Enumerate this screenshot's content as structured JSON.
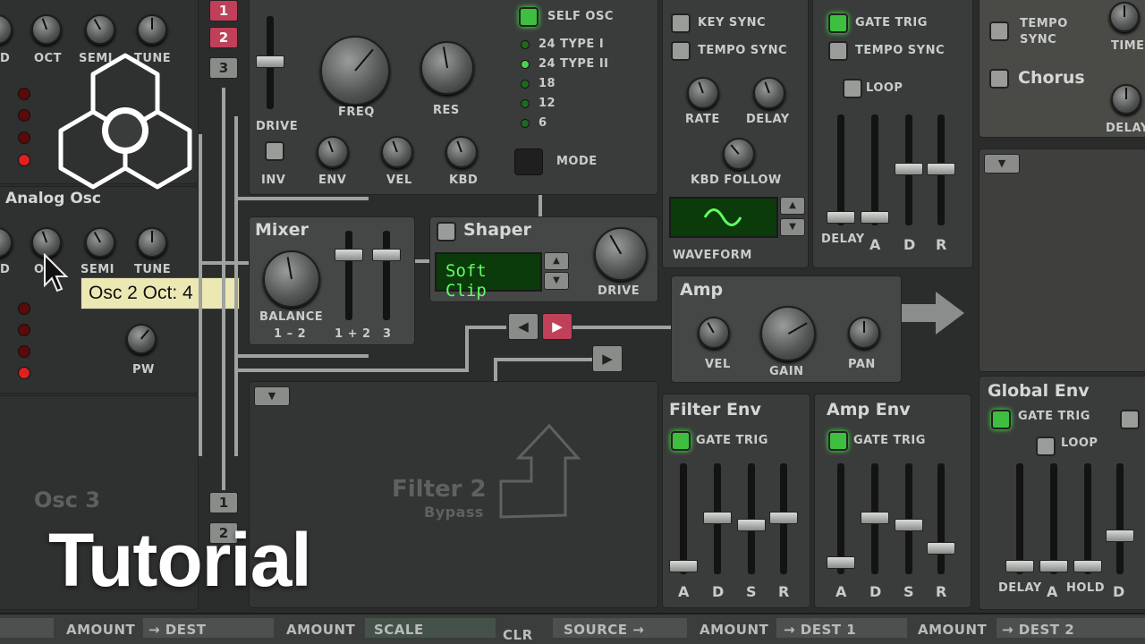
{
  "osc1": {
    "knobs": [
      "D",
      "OCT",
      "SEMI",
      "TUNE"
    ]
  },
  "osc2": {
    "title": "Analog Osc",
    "knobs": [
      "D",
      "O",
      "SEMI",
      "TUNE"
    ],
    "pw": "PW"
  },
  "tooltip": "Osc 2 Oct: 4",
  "osc3": {
    "title": "Osc 3"
  },
  "route_buttons_top": [
    "1",
    "2",
    "3"
  ],
  "route_buttons_bottom": [
    "1",
    "2"
  ],
  "filter1": {
    "drive": "DRIVE",
    "freq": "FREQ",
    "res": "RES",
    "inv": "INV",
    "env": "ENV",
    "vel": "VEL",
    "kbd": "KBD",
    "self_osc": "SELF OSC",
    "types": [
      "24 TYPE I",
      "24 TYPE II",
      "18",
      "12",
      "6"
    ],
    "mode": "MODE"
  },
  "mixer": {
    "title": "Mixer",
    "balance": "BALANCE",
    "balance_range": "1 – 2",
    "f1": "1 + 2",
    "f2": "3"
  },
  "shaper": {
    "title": "Shaper",
    "display": "Soft Clip",
    "drive": "DRIVE"
  },
  "lfo": {
    "key_sync": "KEY SYNC",
    "tempo_sync": "TEMPO SYNC",
    "rate": "RATE",
    "delay": "DELAY",
    "kbd_follow": "KBD FOLLOW",
    "waveform": "WAVEFORM"
  },
  "mod_env": {
    "gate_trig": "GATE TRIG",
    "tempo_sync": "TEMPO SYNC",
    "loop": "LOOP",
    "faders": [
      "DELAY",
      "A",
      "D",
      "R"
    ]
  },
  "amp": {
    "title": "Amp",
    "vel": "VEL",
    "gain": "GAIN",
    "pan": "PAN"
  },
  "filter2": {
    "title": "Filter 2",
    "bypass": "Bypass"
  },
  "filter_env": {
    "title": "Filter Env",
    "gate_trig": "GATE TRIG",
    "faders": [
      "A",
      "D",
      "S",
      "R"
    ]
  },
  "amp_env": {
    "title": "Amp Env",
    "gate_trig": "GATE TRIG",
    "faders": [
      "A",
      "D",
      "S",
      "R"
    ]
  },
  "effects": {
    "delay": "TEMPO SYNC",
    "time": "TIME",
    "chorus": "Chorus",
    "delay_lbl": "DELAY"
  },
  "global_env": {
    "title": "Global Env",
    "gate_trig": "GATE TRIG",
    "loop": "LOOP",
    "faders": [
      "DELAY",
      "A",
      "HOLD",
      "D"
    ]
  },
  "modbus": [
    "AMOUNT",
    "→ DEST",
    "AMOUNT",
    "SCALE",
    "CLR",
    "SOURCE →",
    "AMOUNT",
    "→ DEST 1",
    "AMOUNT",
    "→ DEST 2"
  ],
  "overlay": {
    "title": "Tutorial"
  }
}
